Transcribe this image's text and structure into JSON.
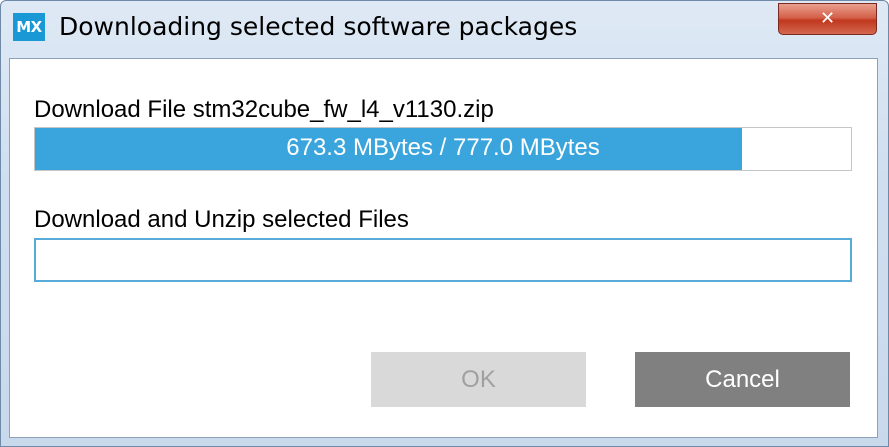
{
  "window": {
    "app_icon": "MX",
    "title": "Downloading selected software packages",
    "close_glyph": "✕"
  },
  "download": {
    "file_label": "Download File stm32cube_fw_l4_v1130.zip",
    "progress_text": "673.3 MBytes / 777.0 MBytes",
    "progress_fraction": 0.8665
  },
  "unzip": {
    "label": "Download and Unzip selected Files",
    "progress_fraction": 0
  },
  "buttons": {
    "ok": "OK",
    "cancel": "Cancel"
  },
  "colors": {
    "progress_fill": "#3aa5dc",
    "app_icon_bg": "#1a98d5",
    "field_border": "#58abd8",
    "cancel_bg": "#808080",
    "ok_bg": "#d9d9d9"
  }
}
